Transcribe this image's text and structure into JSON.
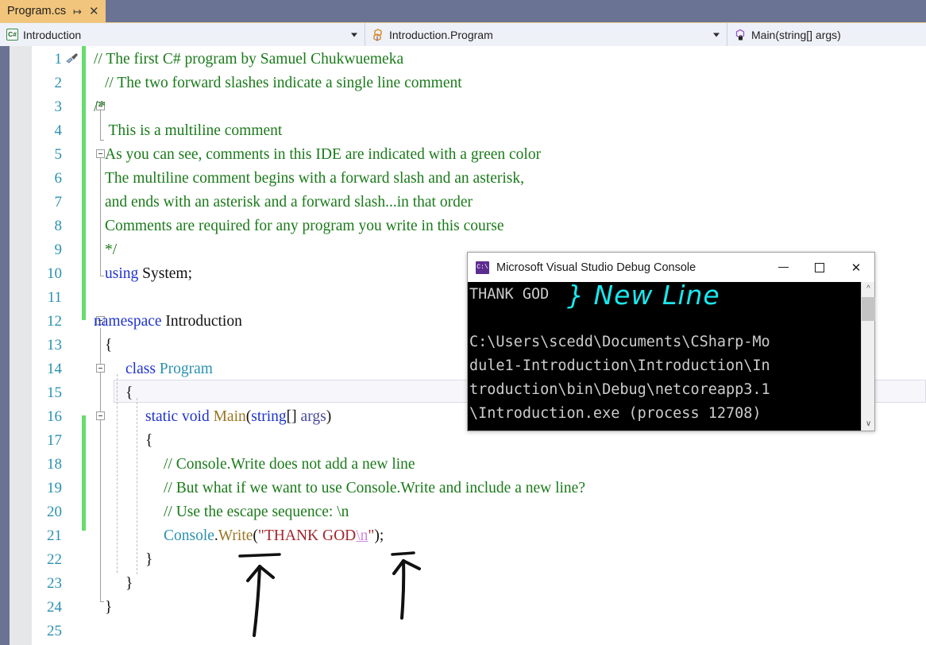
{
  "window": {
    "tab": {
      "label": "Program.cs",
      "pin_icon": "pin-icon",
      "close_icon": "close-icon"
    },
    "navbar": {
      "project": {
        "icon": "csharp-project-icon",
        "text": "Introduction"
      },
      "class": {
        "icon": "class-icon",
        "text": "Introduction.Program"
      },
      "member": {
        "icon": "method-private-icon",
        "text": "Main(string[] args)"
      }
    }
  },
  "editor": {
    "line_numbers": [
      "1",
      "2",
      "3",
      "4",
      "5",
      "6",
      "7",
      "8",
      "9",
      "10",
      "11",
      "12",
      "13",
      "14",
      "15",
      "16",
      "17",
      "18",
      "19",
      "20",
      "21",
      "22",
      "23",
      "24",
      "25"
    ],
    "code_lines": [
      {
        "n": 1,
        "segments": [
          {
            "t": "// The first C# program by Samuel Chukwuemeka",
            "c": "c-comment"
          }
        ],
        "indent": 0
      },
      {
        "n": 2,
        "segments": [
          {
            "t": "// The two forward slashes indicate a single line comment",
            "c": "c-comment"
          }
        ],
        "indent": 1
      },
      {
        "n": 3,
        "segments": [
          {
            "t": "/*",
            "c": "c-comment"
          }
        ],
        "indent": 0
      },
      {
        "n": 4,
        "segments": [
          {
            "t": " This is a multiline comment",
            "c": "c-comment"
          }
        ],
        "indent": 1
      },
      {
        "n": 5,
        "segments": [
          {
            "t": "As you can see, comments in this IDE are indicated with a green color",
            "c": "c-comment"
          }
        ],
        "indent": 1
      },
      {
        "n": 6,
        "segments": [
          {
            "t": "The multiline comment begins with a forward slash and an asterisk,",
            "c": "c-comment"
          }
        ],
        "indent": 1
      },
      {
        "n": 7,
        "segments": [
          {
            "t": "and ends with an asterisk and a forward slash...in that order",
            "c": "c-comment"
          }
        ],
        "indent": 1
      },
      {
        "n": 8,
        "segments": [
          {
            "t": "Comments are required for any program you write in this course",
            "c": "c-comment"
          }
        ],
        "indent": 1
      },
      {
        "n": 9,
        "segments": [
          {
            "t": "*/",
            "c": "c-comment"
          }
        ],
        "indent": 1
      },
      {
        "n": 10,
        "segments": [
          {
            "t": "using",
            "c": "c-keyword"
          },
          {
            "t": " System;",
            "c": "c-plain"
          }
        ],
        "indent": 1
      },
      {
        "n": 11,
        "segments": [],
        "indent": 0
      },
      {
        "n": 12,
        "segments": [
          {
            "t": "namespace",
            "c": "c-keyword"
          },
          {
            "t": " Introduction",
            "c": "c-plain"
          }
        ],
        "indent": 0
      },
      {
        "n": 13,
        "segments": [
          {
            "t": "{",
            "c": "c-brace"
          }
        ],
        "indent": 1
      },
      {
        "n": 14,
        "segments": [
          {
            "t": "class",
            "c": "c-keyword"
          },
          {
            "t": " ",
            "c": "c-plain"
          },
          {
            "t": "Program",
            "c": "c-type"
          }
        ],
        "indent": 2
      },
      {
        "n": 15,
        "segments": [
          {
            "t": "{",
            "c": "c-brace"
          }
        ],
        "indent": 2
      },
      {
        "n": 16,
        "segments": [
          {
            "t": "static void",
            "c": "c-keyword"
          },
          {
            "t": " ",
            "c": "c-plain"
          },
          {
            "t": "Main",
            "c": "c-method"
          },
          {
            "t": "(",
            "c": "c-punct"
          },
          {
            "t": "string",
            "c": "c-keyword"
          },
          {
            "t": "[] ",
            "c": "c-punct"
          },
          {
            "t": "args",
            "c": "c-param"
          },
          {
            "t": ")",
            "c": "c-punct"
          }
        ],
        "indent": 3
      },
      {
        "n": 17,
        "segments": [
          {
            "t": "{",
            "c": "c-brace"
          }
        ],
        "indent": 3
      },
      {
        "n": 18,
        "segments": [
          {
            "t": "// Console.Write does not add a new line",
            "c": "c-comment"
          }
        ],
        "indent": 4
      },
      {
        "n": 19,
        "segments": [
          {
            "t": "// But what if we want to use Console.Write and include a new line?",
            "c": "c-comment"
          }
        ],
        "indent": 4
      },
      {
        "n": 20,
        "segments": [
          {
            "t": "// Use the escape sequence: \\n",
            "c": "c-comment"
          }
        ],
        "indent": 4
      },
      {
        "n": 21,
        "segments": [
          {
            "t": "Console",
            "c": "c-type"
          },
          {
            "t": ".",
            "c": "c-punct"
          },
          {
            "t": "Write",
            "c": "c-method"
          },
          {
            "t": "(",
            "c": "c-punct"
          },
          {
            "t": "\"THANK GOD",
            "c": "c-string"
          },
          {
            "t": "\\n",
            "c": "c-escape"
          },
          {
            "t": "\"",
            "c": "c-string"
          },
          {
            "t": ");",
            "c": "c-punct"
          }
        ],
        "indent": 4
      },
      {
        "n": 22,
        "segments": [
          {
            "t": "}",
            "c": "c-brace"
          }
        ],
        "indent": 3
      },
      {
        "n": 23,
        "segments": [
          {
            "t": "}",
            "c": "c-brace"
          }
        ],
        "indent": 2
      },
      {
        "n": 24,
        "segments": [
          {
            "t": "}",
            "c": "c-brace"
          }
        ],
        "indent": 1
      },
      {
        "n": 25,
        "segments": [],
        "indent": 0
      }
    ],
    "brush_marker_line": 15,
    "colors": {
      "comment": "#1a7a1a",
      "keyword": "#1f33cf",
      "type": "#2b91af",
      "method": "#9b7523",
      "string": "#a2252a",
      "escape": "#cc88dd",
      "linenumber": "#2b91af",
      "changebar": "#64dd6e",
      "tab_active": "#f2c57c",
      "chrome": "#6b7394"
    }
  },
  "console": {
    "title": "Microsoft Visual Studio Debug Console",
    "icon": "console-app-icon",
    "buttons": {
      "minimize": "minimize-icon",
      "maximize": "maximize-icon",
      "close": "close-icon"
    },
    "output_lines": [
      "THANK GOD",
      "",
      "C:\\Users\\scedd\\Documents\\CSharp-Mo",
      "dule1-Introduction\\Introduction\\In",
      "troduction\\bin\\Debug\\netcoreapp3.1",
      "\\Introduction.exe (process 12708)"
    ],
    "scrollbar": {
      "up_icon": "chevron-up-icon",
      "down_icon": "chevron-down-icon"
    }
  },
  "annotations": {
    "newline_label": "} New Line",
    "newline_color": "#18e8ee",
    "arrow_write": "arrow-pointing-to-write",
    "arrow_escape": "arrow-pointing-to-escape-sequence"
  }
}
